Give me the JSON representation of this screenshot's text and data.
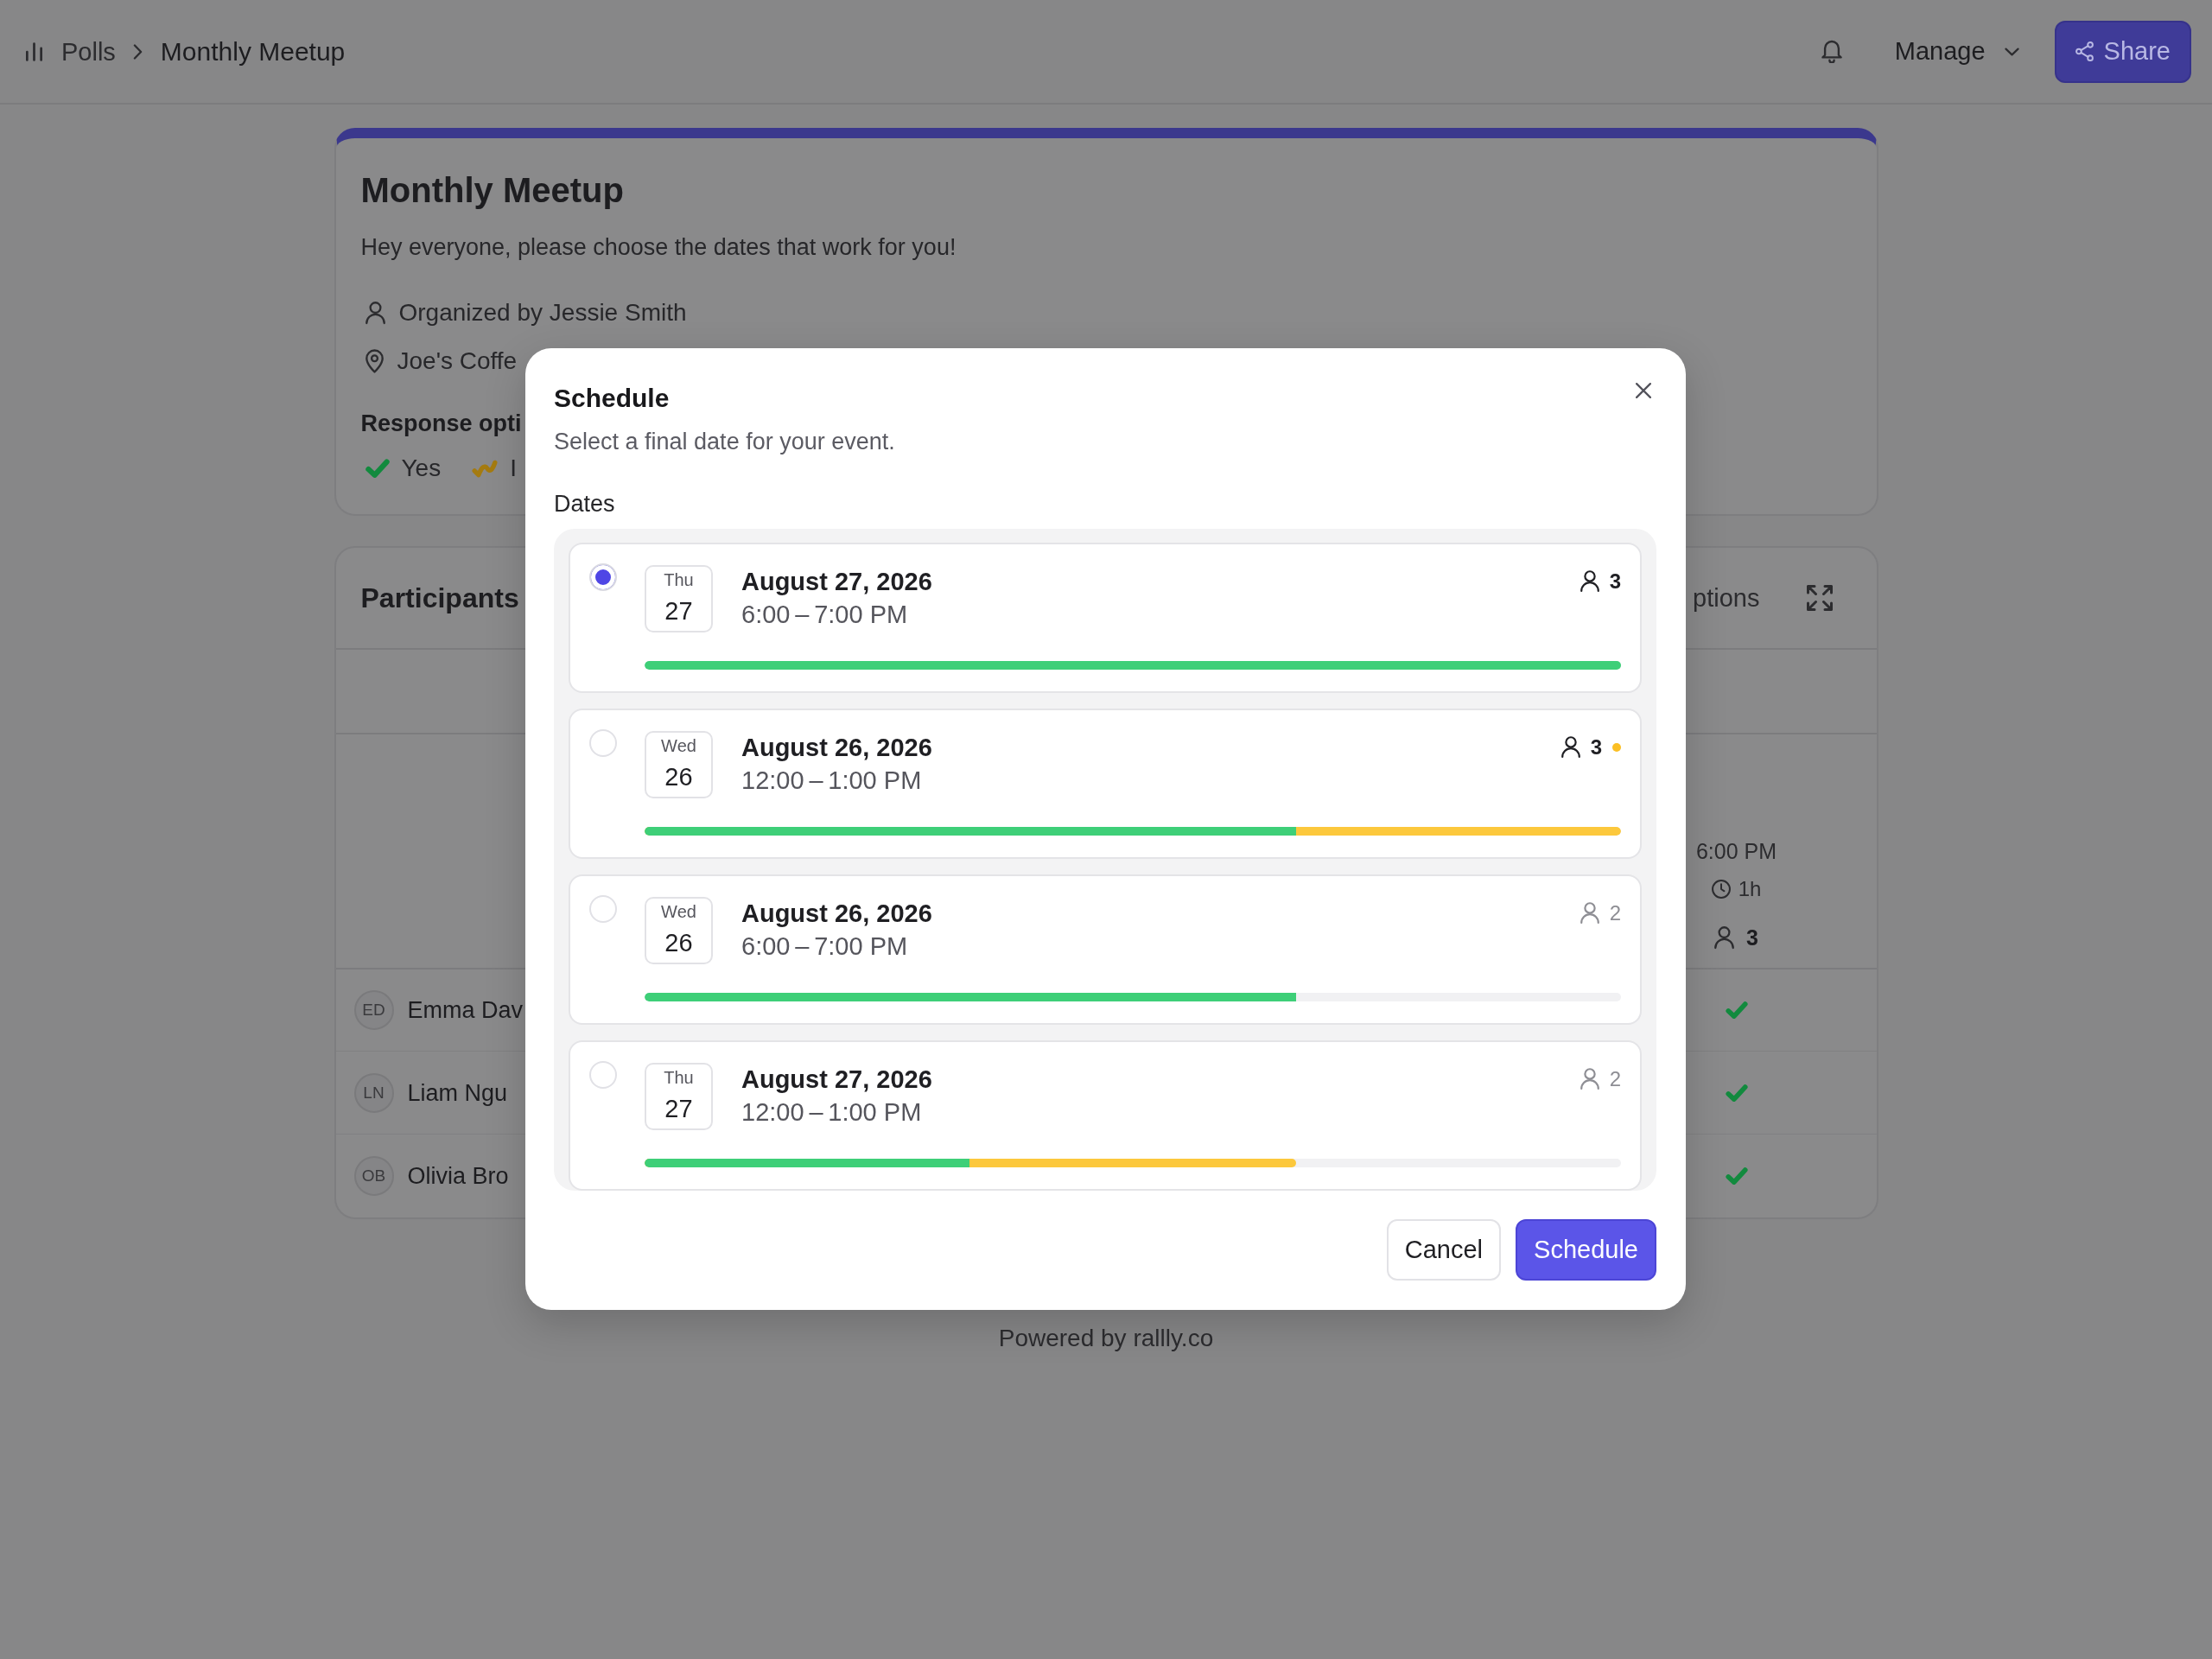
{
  "top_bar": {
    "breadcrumb": [
      {
        "kind": "link",
        "label": "Polls"
      },
      {
        "kind": "current",
        "label": "Monthly Meetup"
      }
    ],
    "manage_label": "Manage",
    "share_label": "Share"
  },
  "poll": {
    "title": "Monthly Meetup",
    "description": "Hey everyone, please choose the dates that work for you!",
    "organizer": "Organized by Jessie Smith",
    "location": "Joe's Coffe",
    "response_options_label": "Response opti",
    "response_options": [
      {
        "kind": "yes",
        "label": "Yes"
      },
      {
        "kind": "if_need_be",
        "label": "I"
      }
    ]
  },
  "participants": {
    "title": "Participants",
    "options_label": "ptions",
    "option_column": {
      "time": "6:00 PM",
      "duration": "1h",
      "count": "3"
    },
    "rows": [
      {
        "initials": "ED",
        "name": "Emma Dav",
        "kind": "yes"
      },
      {
        "initials": "LN",
        "name": "Liam Ngu",
        "kind": "yes"
      },
      {
        "initials": "OB",
        "name": "Olivia Bro",
        "kind": "yes"
      }
    ]
  },
  "footer": "Powered by rallly.co",
  "dialog": {
    "title": "Schedule",
    "subtitle": "Select a final date for your event.",
    "dates_label": "Dates",
    "dates": [
      {
        "selected": true,
        "weekday": "Thu",
        "day": "27",
        "date": "August 27, 2026",
        "time": "6:00 – 7:00 PM",
        "count": "3",
        "count_highlighted": true,
        "attention_dot": false,
        "votes_bar": {
          "yes": {
            "level": 1
          }
        }
      },
      {
        "selected": false,
        "weekday": "Wed",
        "day": "26",
        "date": "August 26, 2026",
        "time": "12:00 – 1:00 PM",
        "count": "3",
        "count_highlighted": true,
        "attention_dot": true,
        "votes_bar": {
          "yes": {
            "level": 0.667
          },
          "yes_or_if_need_be": {
            "level": 1
          }
        }
      },
      {
        "selected": false,
        "weekday": "Wed",
        "day": "26",
        "date": "August 26, 2026",
        "time": "6:00 – 7:00 PM",
        "count": "2",
        "count_highlighted": false,
        "attention_dot": false,
        "votes_bar": {
          "yes": {
            "level": 0.667
          }
        }
      },
      {
        "selected": false,
        "weekday": "Thu",
        "day": "27",
        "date": "August 27, 2026",
        "time": "12:00 – 1:00 PM",
        "count": "2",
        "count_highlighted": false,
        "attention_dot": false,
        "votes_bar": {
          "yes": {
            "level": 0.333
          },
          "yes_or_if_need_be": {
            "level": 0.667
          }
        }
      }
    ],
    "buttons": [
      {
        "kind": "secondary",
        "label": "Cancel"
      },
      {
        "kind": "primary",
        "label": "Schedule"
      }
    ]
  }
}
